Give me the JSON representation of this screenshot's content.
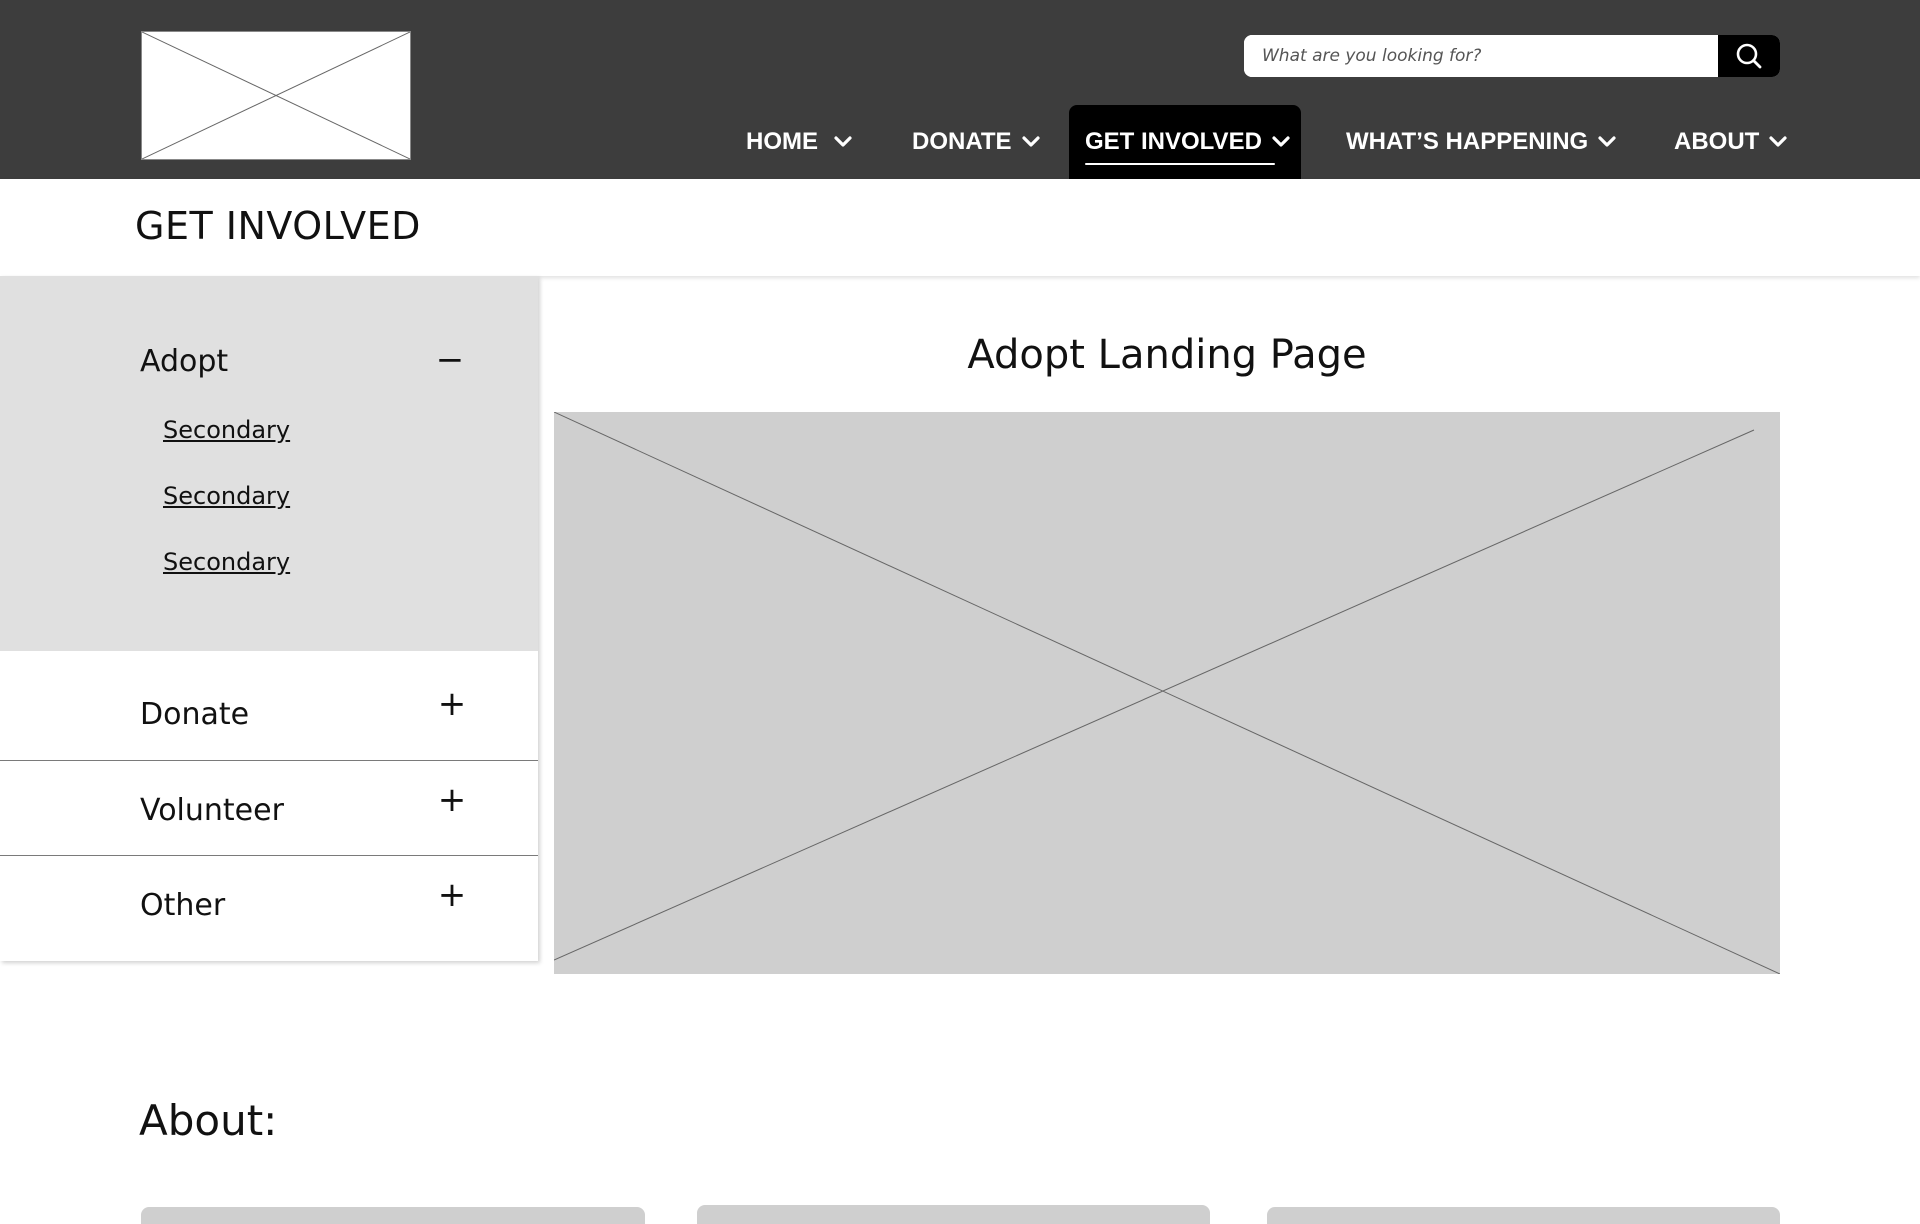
{
  "header": {
    "search": {
      "placeholder": "What are you looking for?"
    },
    "nav": [
      {
        "label": "HOME"
      },
      {
        "label": "DONATE"
      },
      {
        "label": "GET INVOLVED",
        "active": true
      },
      {
        "label": "WHAT’S HAPPENING"
      },
      {
        "label": "ABOUT"
      }
    ]
  },
  "page": {
    "title": "GET INVOLVED"
  },
  "sidebar": {
    "open_section": {
      "title": "Adopt",
      "toggle": "−",
      "links": [
        "Secondary",
        "Secondary",
        "Secondary"
      ]
    },
    "sections": [
      {
        "title": "Donate",
        "toggle": "+"
      },
      {
        "title": "Volunteer",
        "toggle": "+"
      },
      {
        "title": "Other",
        "toggle": "+"
      }
    ]
  },
  "main": {
    "heading": "Adopt Landing Page"
  },
  "about": {
    "heading": "About:"
  },
  "colors": {
    "header_bg": "#3d3d3d",
    "active_nav_bg": "#000000",
    "sidebar_open_bg": "#e0e0e0",
    "placeholder_gray": "#cfcfcf"
  },
  "icons": {
    "search": "search-icon",
    "chevron": "chevron-down-icon"
  }
}
